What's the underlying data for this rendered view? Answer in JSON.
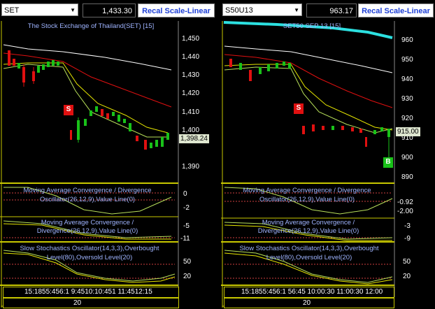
{
  "left": {
    "symbol": "SET",
    "price": "1,433.30",
    "recal_label": "Recal Scale-Linear",
    "title": "The Stock Exchange of Thailand(SET) [15]",
    "y_ticks": [
      "1,450",
      "1,440",
      "1,430",
      "1,420",
      "1,410",
      "1,400",
      "1,390"
    ],
    "price_tag": "1,398.24",
    "signal": "S",
    "macd_label": "Moving Average Convergence / Divergence Oscillator(26,12,9),Value Line(0)",
    "macd_ticks": [
      "0",
      "-2"
    ],
    "macd2_label": "Moving Average Convergence / Divergence(26,12,9),Value Line(0)",
    "macd2_ticks": [
      "-5",
      "-11"
    ],
    "stoch_label": "Slow Stochastics Oscillator(14,3,3),Overbought Level(80),Oversold Level(20)",
    "stoch_ticks": [
      "50",
      "20"
    ],
    "time_labels": "15:1855:456:1 9:4510:10:451 11:4512:15",
    "date_label": "20"
  },
  "right": {
    "symbol": "S50U13",
    "price": "963.17",
    "recal_label": "Recal Scale-Linear",
    "title": "SET50 SEP 13  [15]",
    "y_ticks": [
      "960",
      "950",
      "940",
      "930",
      "920",
      "910",
      "900",
      "890"
    ],
    "price_tag": "915.00",
    "signal_s": "S",
    "signal_b": "B",
    "macd_label": "Moving Average Convergence / Divergence Oscillator(26,12,9),Value Line(0)",
    "macd_ticks": [
      "-0.92",
      "-2.00"
    ],
    "macd2_label": "Moving Average Convergence / Divergence(26,12,9),Value Line(0)",
    "macd2_ticks": [
      "-3",
      "-9"
    ],
    "stoch_label": "Slow Stochastics Oscillator(14,3,3),Overbought Level(80),Oversold Level(20)",
    "stoch_ticks": [
      "50",
      "20"
    ],
    "time_labels": "15:1855:456:1 56:45 10:00:30 11:00:30 12:00",
    "date_label": "20"
  },
  "colors": {
    "background": "#000000",
    "recal_text": "#1d3fd6",
    "label_text": "#9fb4ff",
    "ma_white": "#ffffff",
    "ma_red": "#e01010",
    "ma_yellow": "#e6e600",
    "ma_green": "#b8e05a",
    "candle_green": "#19c219",
    "candle_red": "#e01010",
    "separator": "#c8c800",
    "dotted_red": "#d04040",
    "cyan_line": "#2ce0e0"
  }
}
